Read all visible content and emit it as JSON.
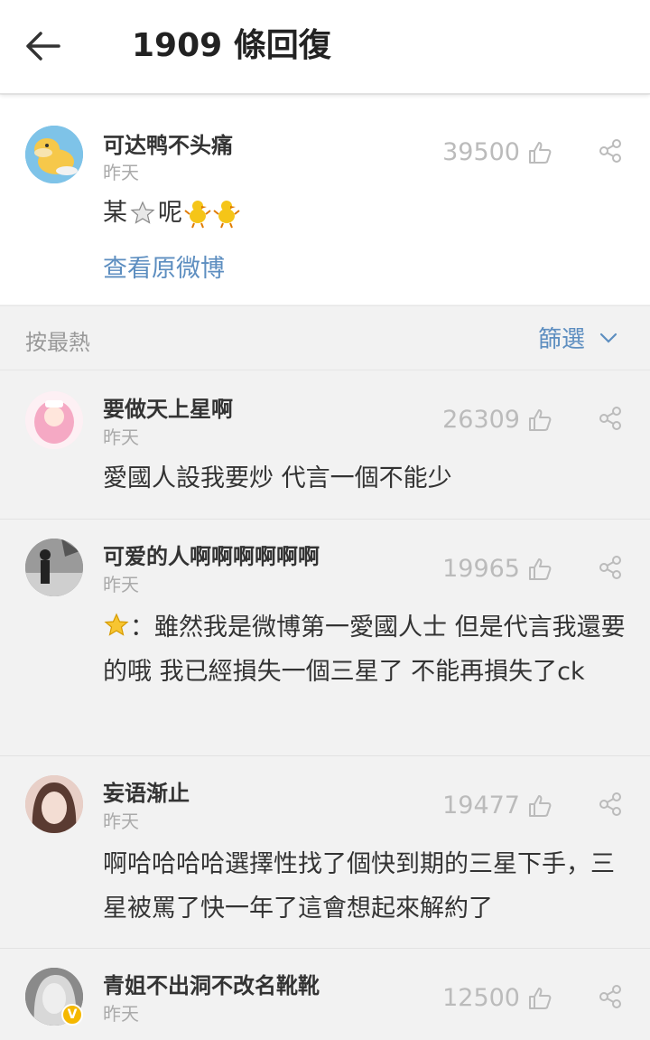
{
  "header": {
    "title": "1909 條回復"
  },
  "original": {
    "username": "可达鸭不头痛",
    "time": "昨天",
    "likes": "39500",
    "text_a": "某",
    "text_b": "呢",
    "view_original": "查看原微博"
  },
  "sortbar": {
    "sort_label": "按最熱",
    "filter_label": "篩選"
  },
  "comments": [
    {
      "username": "要做天上星啊",
      "time": "昨天",
      "likes": "26309",
      "text": "愛國人設我要炒 代言一個不能少"
    },
    {
      "username": "可爱的人啊啊啊啊啊啊",
      "time": "昨天",
      "likes": "19965",
      "text": "：雖然我是微博第一愛國人士 但是代言我還要的哦 我已經損失一個三星了 不能再損失了ck"
    },
    {
      "username": "妄语渐止",
      "time": "昨天",
      "likes": "19477",
      "text": "啊哈哈哈哈選擇性找了個快到期的三星下手，三星被罵了快一年了這會想起來解約了"
    },
    {
      "username": "青姐不出洞不改名靴靴",
      "time": "昨天",
      "likes": "12500"
    }
  ]
}
